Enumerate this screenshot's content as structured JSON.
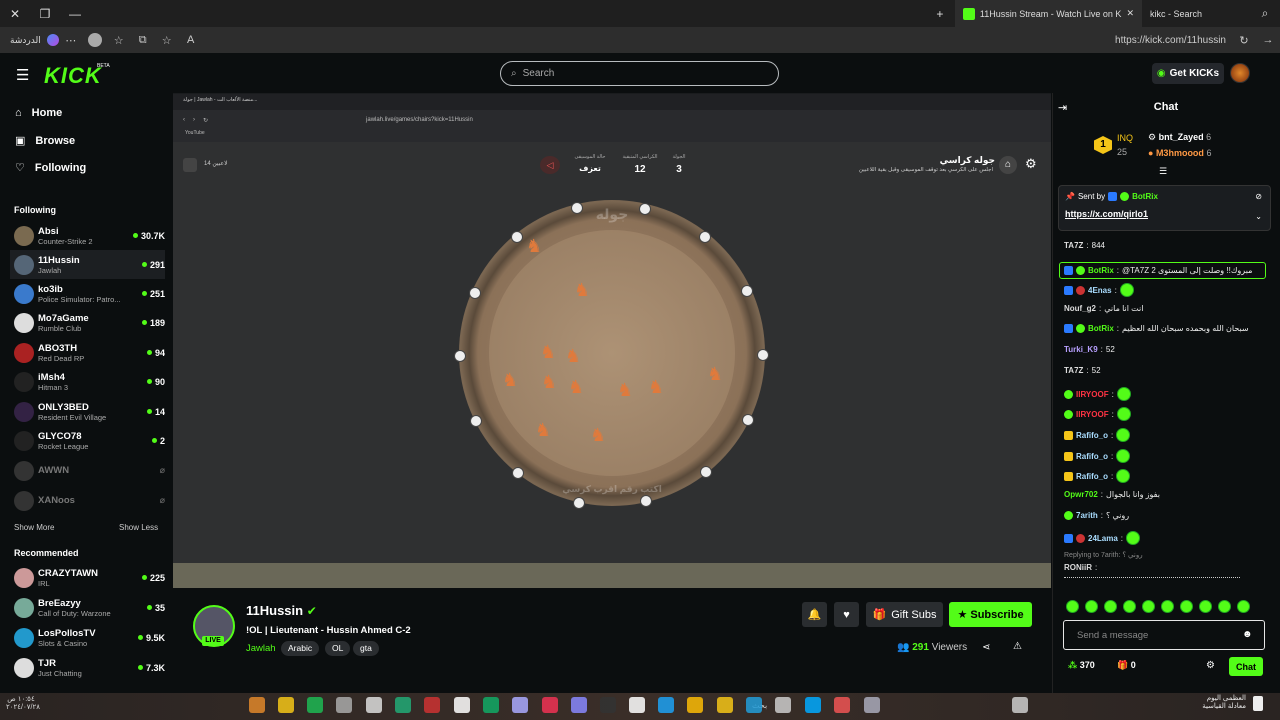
{
  "browser": {
    "tabs": [
      {
        "label": "11Hussin Stream - Watch Live on K"
      },
      {
        "label": "kikc - Search"
      }
    ],
    "url": "https://kick.com/11hussin",
    "left_label": "الدردشة"
  },
  "header": {
    "logo": "KICK",
    "beta": "BETA",
    "search_placeholder": "Search",
    "get_kicks": "Get KICKs"
  },
  "sidebar": {
    "nav": [
      {
        "label": "Home",
        "icon": "home-icon"
      },
      {
        "label": "Browse",
        "icon": "compass-icon"
      },
      {
        "label": "Following",
        "icon": "heart-icon"
      }
    ],
    "following_title": "Following",
    "following": [
      {
        "name": "Absi",
        "game": "Counter-Strike 2",
        "viewers": "30.7K",
        "live": true,
        "color": "#7a6a50"
      },
      {
        "name": "11Hussin",
        "game": "Jawlah",
        "viewers": "291",
        "live": true,
        "color": "#556677"
      },
      {
        "name": "ko3ib",
        "game": "Police Simulator: Patro...",
        "viewers": "251",
        "live": true,
        "color": "#3a7acc"
      },
      {
        "name": "Mo7aGame",
        "game": "Rumble Club",
        "viewers": "189",
        "live": true,
        "color": "#ddd"
      },
      {
        "name": "ABO3TH",
        "game": "Red Dead RP",
        "viewers": "94",
        "live": true,
        "color": "#aa2222"
      },
      {
        "name": "iMsh4",
        "game": "Hitman 3",
        "viewers": "90",
        "live": true,
        "color": "#222"
      },
      {
        "name": "ONLY3BED",
        "game": "Resident Evil Village",
        "viewers": "14",
        "live": true,
        "color": "#332244"
      },
      {
        "name": "GLYCO78",
        "game": "Rocket League",
        "viewers": "2",
        "live": true,
        "color": "#222"
      },
      {
        "name": "AWWN",
        "game": "",
        "viewers": "",
        "live": false,
        "color": "#333"
      },
      {
        "name": "XANoos",
        "game": "",
        "viewers": "",
        "live": false,
        "color": "#333"
      }
    ],
    "show_more": "Show More",
    "show_less": "Show Less",
    "recommended_title": "Recommended",
    "recommended": [
      {
        "name": "CRAZYTAWN",
        "game": "IRL",
        "viewers": "225",
        "color": "#c99"
      },
      {
        "name": "BreEazyy",
        "game": "Call of Duty: Warzone",
        "viewers": "35",
        "color": "#7a9"
      },
      {
        "name": "LosPollosTV",
        "game": "Slots & Casino",
        "viewers": "9.5K",
        "color": "#29c"
      },
      {
        "name": "TJR",
        "game": "Just Chatting",
        "viewers": "7.3K",
        "color": "#ddd"
      }
    ]
  },
  "stream_view": {
    "inner_url": "jawlah.live/games/chairs?kick=11Hussin",
    "inner_tab": "جولة | Jawlah - منصة الألعاب الت...",
    "bookmark": "YouTube",
    "game_title": "جوله كراسي",
    "game_subtitle": "اجلس على الكرسي بعد توقف الموسيقى وقبل بقية اللاعبين",
    "round_label": "الجولة",
    "round_value": "3",
    "chairs_label": "الكراسي المتبقية",
    "chairs_value": "12",
    "music_label": "حالة الموسيقى",
    "music_value": "تعزف",
    "players_label": "14 لاعبين",
    "circle_top": "جوله",
    "circle_bottom": "اكتب رقم اقرب كرسي"
  },
  "streamer": {
    "name": "11Hussin",
    "title": "!OL | Lieutenant - Hussin Ahmed C-2",
    "category": "Jawlah",
    "tags": [
      "Arabic",
      "OL",
      "gta"
    ],
    "live": "LIVE",
    "viewers": "291",
    "viewers_label": "Viewers",
    "gift_subs": "Gift Subs",
    "subscribe": "Subscribe"
  },
  "chat": {
    "title": "Chat",
    "leaderboard": [
      {
        "rank": "1",
        "name": "INQ",
        "score": "25"
      },
      {
        "name": "bnt_Zayed",
        "score": "6"
      },
      {
        "name": "M3hmoood",
        "score": "6"
      }
    ],
    "pinned": {
      "sent_by": "Sent by",
      "user": "BotRix",
      "link": "https://x.com/qirlo1"
    },
    "messages": [
      {
        "user": "TA7Z",
        "text": "844",
        "color": "#ddd"
      },
      {
        "user": "BotRix",
        "text": "@TA7Z مبروك!! وصلت إلى المستوى 2",
        "color": "#53fc18"
      },
      {
        "user": "4Enas",
        "text": "",
        "color": "#aaddff"
      },
      {
        "user": "Nouf_g2",
        "text": "انت انا ماني",
        "color": "#ddd"
      },
      {
        "user": "BotRix",
        "text": "سبحان الله وبحمده سبحان الله العظيم",
        "color": "#53fc18"
      },
      {
        "user": "Turki_K9",
        "text": "52",
        "color": "#b8a0ff"
      },
      {
        "user": "TA7Z",
        "text": "52",
        "color": "#ddd"
      },
      {
        "user": "IIRYOOF",
        "text": "",
        "color": "#ff3344"
      },
      {
        "user": "IIRYOOF",
        "text": "",
        "color": "#ff3344"
      },
      {
        "user": "Rafifo_o",
        "text": "",
        "color": "#aaddff"
      },
      {
        "user": "Rafifo_o",
        "text": "",
        "color": "#aaddff"
      },
      {
        "user": "Rafifo_o",
        "text": "",
        "color": "#aaddff"
      },
      {
        "user": "Opwr702",
        "text": "بفوز وانا بالجوال",
        "color": "#53fc18"
      },
      {
        "user": "7arith",
        "text": "روني ؟",
        "color": "#aaddff"
      },
      {
        "user": "24Lama",
        "text": "",
        "color": "#aaddff"
      }
    ],
    "reply_to": "Replying to 7arith: روني ؟",
    "last_user": "RONiiR",
    "input_placeholder": "Send a message",
    "points": "370",
    "gifts": "0",
    "send": "Chat"
  },
  "taskbar": {
    "date": "٢٠٢٤/٠٧/٢٨",
    "time": "١٠:٥٤ ص",
    "weather": "العظمى اليوم",
    "weather2": "معادلة القياسية",
    "search": "بحث"
  }
}
